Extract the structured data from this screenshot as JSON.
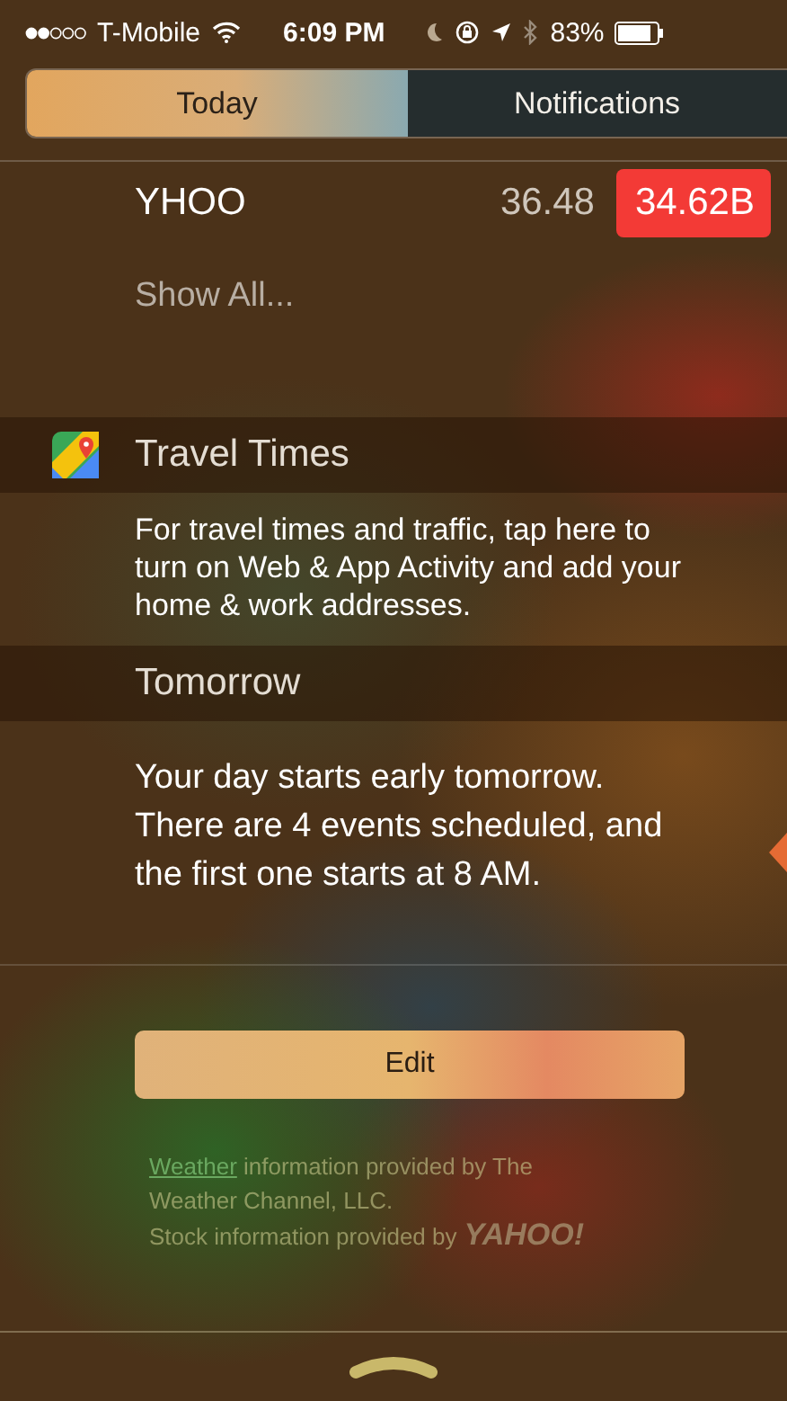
{
  "status_bar": {
    "carrier": "T-Mobile",
    "time": "6:09 PM",
    "battery": "83%"
  },
  "tabs": [
    {
      "label": "Today",
      "selected": true
    },
    {
      "label": "Notifications",
      "selected": false
    }
  ],
  "stocks": [
    {
      "symbol": "YHOO",
      "price": "36.48",
      "change": "34.62B"
    }
  ],
  "show_all": "Show All...",
  "widgets": [
    {
      "kind": "maps",
      "title": "Travel Times",
      "body": [
        "For travel times and traffic, tap here to",
        "turn on Web & App Activity and add your",
        "home & work addresses."
      ]
    },
    {
      "kind": "plain",
      "title": "Tomorrow",
      "body": [
        "Your day starts early tomorrow.",
        "There are 4 events scheduled, and",
        "the first one starts at 8 AM."
      ]
    }
  ],
  "edit_button": "Edit",
  "footer": {
    "weather_link": "Weather",
    "weather_text": "information provided by The Weather Channel, LLC.",
    "stock_text": "Stock information provided by",
    "stock_logo": "YAHOO!"
  }
}
